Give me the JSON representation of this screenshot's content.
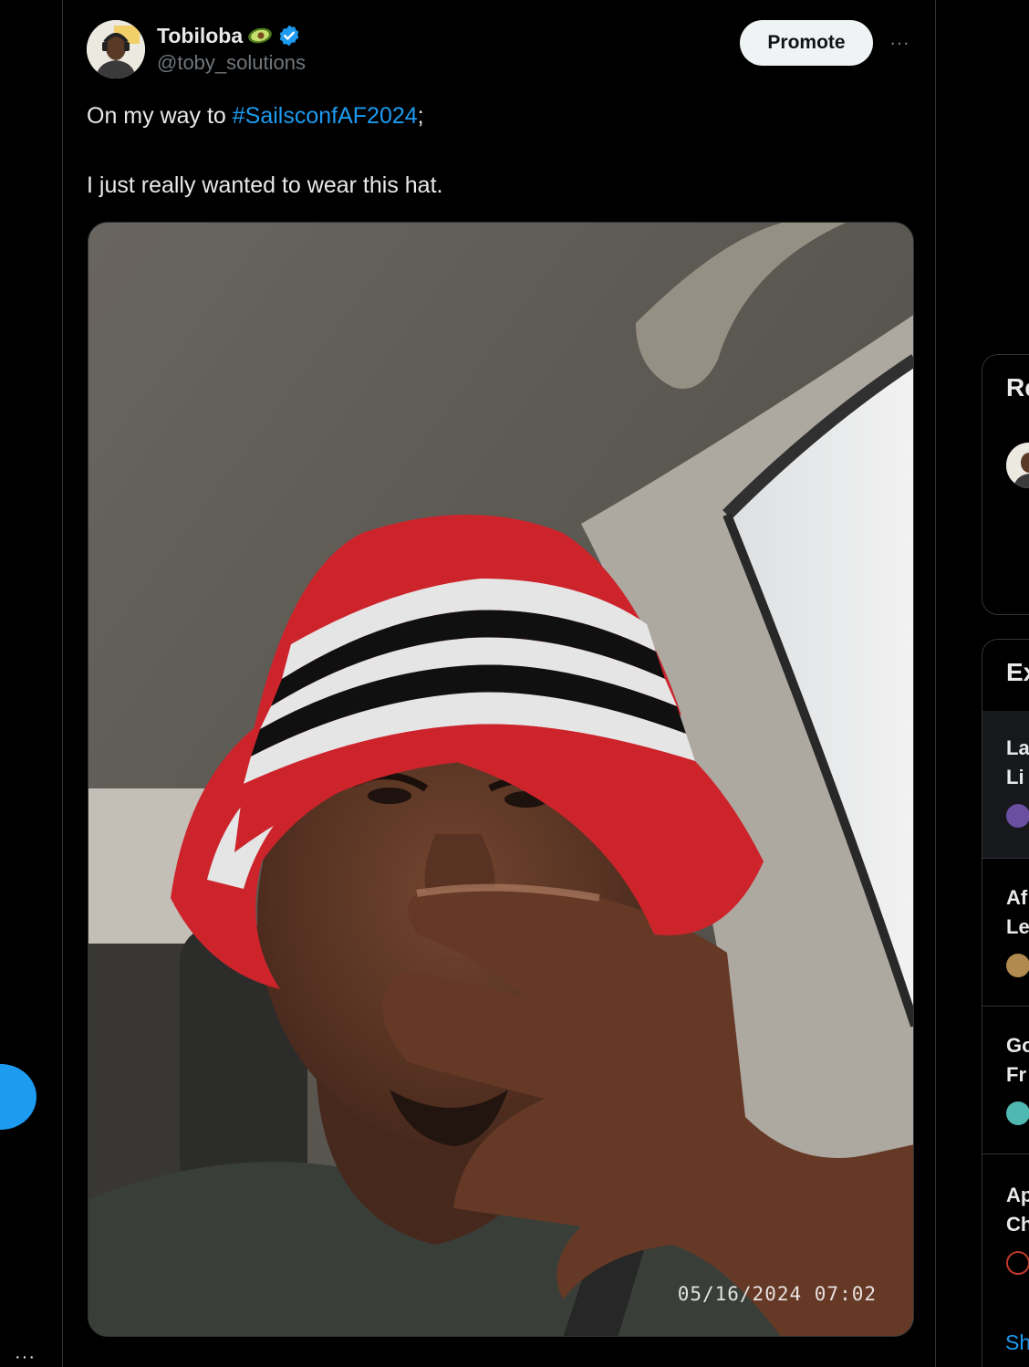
{
  "tweet": {
    "display_name": "Tobiloba",
    "name_emoji": "avocado-emoji",
    "verified": true,
    "handle": "@toby_solutions",
    "promote_label": "Promote",
    "more_label": "···",
    "text_prefix": "On my way to ",
    "hashtag": "#SailsconfAF2024",
    "text_suffix": ";",
    "text_line2": "I just really wanted to wear this hat.",
    "media_timestamp": "05/16/2024  07:02"
  },
  "sidebar": {
    "card1_title": "Re",
    "card2_title": "Ex",
    "trends": [
      {
        "line1": "La",
        "line2": "Li"
      },
      {
        "line1": "Af",
        "line2": "Le"
      },
      {
        "line1": "Go",
        "line2": "Fr"
      },
      {
        "line1": "Ap",
        "line2": "Ch"
      }
    ],
    "show_more": "Sh"
  },
  "left_rail": {
    "more_label": "···"
  },
  "colors": {
    "accent": "#1d9bf0",
    "background": "#000000",
    "text": "#e7e9ea",
    "muted": "#71767b"
  }
}
